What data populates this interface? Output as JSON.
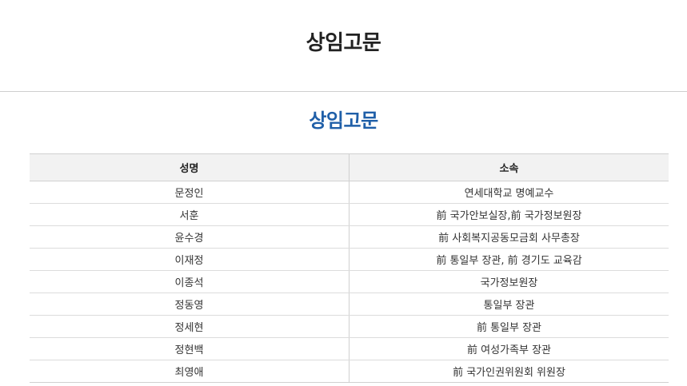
{
  "header": {
    "title": "상임고문"
  },
  "section": {
    "title": "상임고문"
  },
  "table": {
    "columns": [
      "성명",
      "소속"
    ],
    "rows": [
      {
        "name": "문정인",
        "org": "연세대학교 명예교수"
      },
      {
        "name": "서훈",
        "org": "前 국가안보실장,前 국가정보원장"
      },
      {
        "name": "윤수경",
        "org": "前 사회복지공동모금회 사무총장"
      },
      {
        "name": "이재정",
        "org": "前 통일부 장관, 前 경기도 교육감"
      },
      {
        "name": "이종석",
        "org": "국가정보원장"
      },
      {
        "name": "정동영",
        "org": "통일부 장관"
      },
      {
        "name": "정세현",
        "org": "前 통일부 장관"
      },
      {
        "name": "정현백",
        "org": "前 여성가족부 장관"
      },
      {
        "name": "최영애",
        "org": "前 국가인권위원회 위원장"
      }
    ]
  },
  "colors": {
    "section_title": "#1f5fa8",
    "header_bg": "#f2f2f2"
  }
}
